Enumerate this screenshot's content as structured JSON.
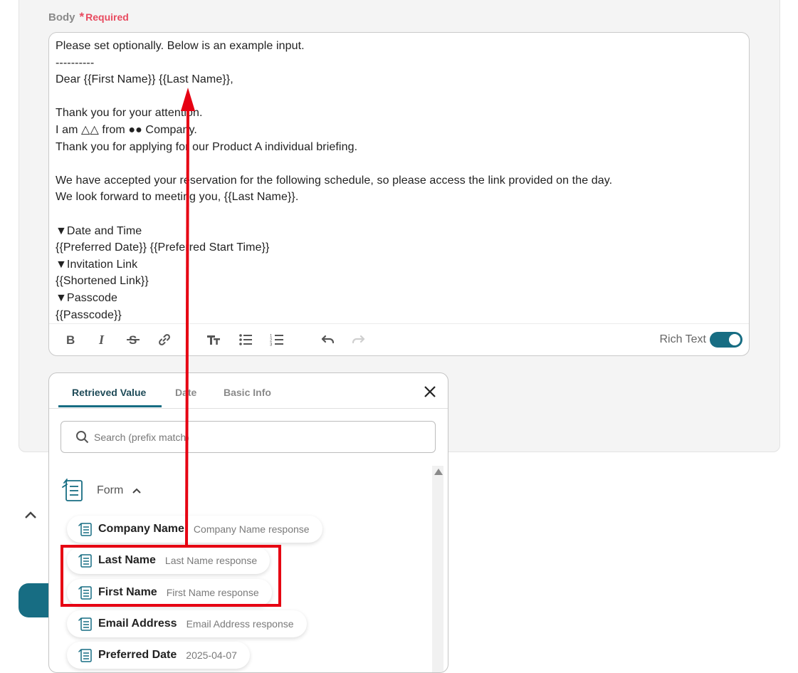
{
  "field": {
    "label": "Body",
    "required_star": "*",
    "required_text": "Required"
  },
  "editor": {
    "lines": [
      "Please set optionally. Below is an example input.",
      "----------",
      "Dear {{First Name}} {{Last Name}},",
      "",
      "Thank you for your attention.",
      "I am △△ from ●● Company.",
      "Thank you for applying for our Product A individual briefing.",
      "",
      "We have accepted your reservation for the following schedule, so please access the link provided on the day.",
      "We look forward to meeting you, {{Last Name}}.",
      "",
      "▼Date and Time",
      "{{Preferred Date}} {{Preferred Start Time}}",
      "▼Invitation Link",
      "{{Shortened Link}}",
      "▼Passcode",
      "{{Passcode}}"
    ],
    "toolbar": {
      "icons": [
        "bold-icon",
        "italic-icon",
        "strikethrough-icon",
        "link-icon",
        "text-size-icon",
        "bullet-list-icon",
        "numbered-list-icon",
        "undo-icon",
        "redo-icon"
      ],
      "rich_text_label": "Rich Text",
      "rich_text_on": true,
      "accent_color": "#176d83"
    }
  },
  "popup": {
    "tabs": [
      {
        "label": "Retrieved Value",
        "active": true
      },
      {
        "label": "Date",
        "active": false
      },
      {
        "label": "Basic Info",
        "active": false
      }
    ],
    "search_placeholder": "Search (prefix match)",
    "group": {
      "label": "Form",
      "expanded": true
    },
    "items": [
      {
        "name": "Company Name",
        "desc": "Company Name response"
      },
      {
        "name": "Last Name",
        "desc": "Last Name response"
      },
      {
        "name": "First Name",
        "desc": "First Name response"
      },
      {
        "name": "Email Address",
        "desc": "Email Address response"
      },
      {
        "name": "Preferred Date",
        "desc": "2025-04-07"
      }
    ]
  },
  "annotation": {
    "highlight_color": "#e60012"
  }
}
